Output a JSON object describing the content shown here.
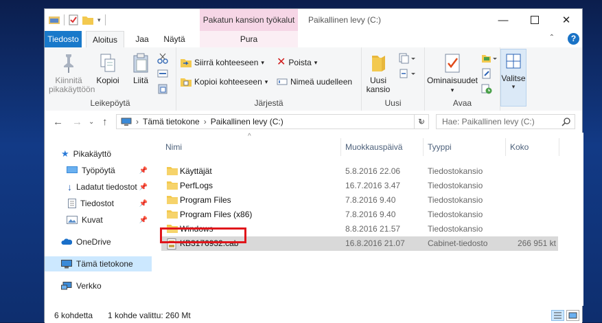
{
  "window": {
    "title": "Paikallinen levy (C:)",
    "context_tab_title": "Pakatun kansion työkalut"
  },
  "tabs": {
    "file": "Tiedosto",
    "home": "Aloitus",
    "share": "Jaa",
    "view": "Näytä",
    "context": "Pura"
  },
  "ribbon": {
    "clipboard": {
      "label": "Leikepöytä",
      "pin_line1": "Kiinnitä",
      "pin_line2": "pikakäyttöön",
      "copy": "Kopioi",
      "paste": "Liitä"
    },
    "organize": {
      "label": "Järjestä",
      "move_to": "Siirrä kohteeseen",
      "copy_to": "Kopioi kohteeseen",
      "delete": "Poista",
      "rename": "Nimeä uudelleen"
    },
    "new": {
      "label": "Uusi",
      "new_folder_line1": "Uusi",
      "new_folder_line2": "kansio"
    },
    "open": {
      "label": "Avaa",
      "properties": "Ominaisuudet"
    },
    "select": {
      "select": "Valitse"
    }
  },
  "address": {
    "crumbs": [
      "Tämä tietokone",
      "Paikallinen levy (C:)"
    ],
    "search_placeholder": "Hae: Paikallinen levy (C:)"
  },
  "nav": {
    "quick_access": "Pikakäyttö",
    "items": [
      "Työpöytä",
      "Ladatut tiedostot",
      "Tiedostot",
      "Kuvat"
    ],
    "onedrive": "OneDrive",
    "this_pc": "Tämä tietokone",
    "network": "Verkko"
  },
  "columns": {
    "name": "Nimi",
    "modified": "Muokkauspäivä",
    "type": "Tyyppi",
    "size": "Koko"
  },
  "files": [
    {
      "name": "Käyttäjät",
      "modified": "5.8.2016 22.06",
      "type": "Tiedostokansio",
      "size": ""
    },
    {
      "name": "PerfLogs",
      "modified": "16.7.2016 3.47",
      "type": "Tiedostokansio",
      "size": ""
    },
    {
      "name": "Program Files",
      "modified": "7.8.2016 9.40",
      "type": "Tiedostokansio",
      "size": ""
    },
    {
      "name": "Program Files (x86)",
      "modified": "7.8.2016 9.40",
      "type": "Tiedostokansio",
      "size": ""
    },
    {
      "name": "Windows",
      "modified": "8.8.2016 21.57",
      "type": "Tiedostokansio",
      "size": ""
    },
    {
      "name": "KB3176932.cab",
      "modified": "16.8.2016 21.07",
      "type": "Cabinet-tiedosto",
      "size": "266 951 kt"
    }
  ],
  "status": {
    "count": "6 kohdetta",
    "selection": "1 kohde valittu: 260 Mt"
  },
  "colors": {
    "file_tab": "#1979ca",
    "context_tab": "#f6d6e6",
    "selection_nav": "#cce8ff",
    "highlight_box": "#e0151b"
  }
}
